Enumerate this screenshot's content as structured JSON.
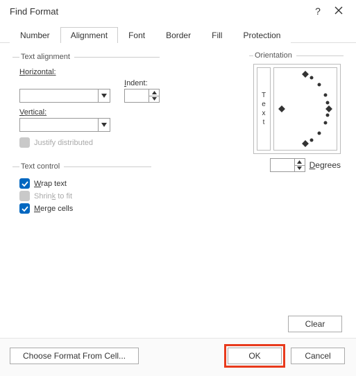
{
  "title": "Find Format",
  "tabs": [
    "Number",
    "Alignment",
    "Font",
    "Border",
    "Fill",
    "Protection"
  ],
  "activeTab": "Alignment",
  "textAlignment": {
    "legend": "Text alignment",
    "horizontalLabel": "Horizontal:",
    "horizontalValue": "",
    "verticalLabel": "Vertical:",
    "verticalValue": "",
    "indentLabel": "Indent:",
    "indentValue": "",
    "justifyDistributedLabel": "Justify distributed"
  },
  "textControl": {
    "legend": "Text control",
    "wrapTextLabel": "Wrap text",
    "shrinkLabel": "Shrink to fit",
    "mergeLabel": "Merge cells"
  },
  "orientation": {
    "legend": "Orientation",
    "vertical": [
      "T",
      "e",
      "x",
      "t"
    ],
    "degreesValue": "",
    "degreesLabel": "Degrees"
  },
  "buttons": {
    "clear": "Clear",
    "chooseFormat": "Choose Format From Cell...",
    "ok": "OK",
    "cancel": "Cancel"
  }
}
